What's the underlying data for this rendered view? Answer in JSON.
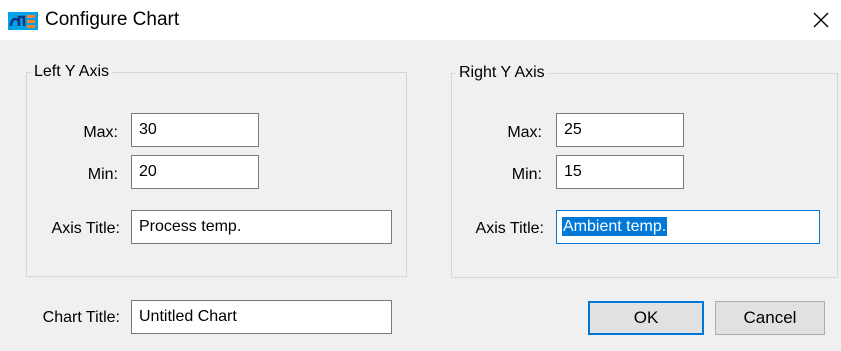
{
  "window": {
    "title": "Configure Chart",
    "icon": "chart-app-icon",
    "close_icon": "close-icon"
  },
  "left_axis": {
    "legend": "Left Y Axis",
    "max_label": "Max:",
    "max_value": "30",
    "min_label": "Min:",
    "min_value": "20",
    "title_label": "Axis Title:",
    "title_value": "Process temp."
  },
  "right_axis": {
    "legend": "Right Y Axis",
    "max_label": "Max:",
    "max_value": "25",
    "min_label": "Min:",
    "min_value": "15",
    "title_label": "Axis Title:",
    "title_value": "Ambient temp."
  },
  "chart": {
    "title_label": "Chart Title:",
    "title_value": "Untitled Chart"
  },
  "buttons": {
    "ok": "OK",
    "cancel": "Cancel"
  },
  "colors": {
    "accent": "#0078d7",
    "dialog_bg": "#f0f0f0",
    "icon_blue": "#00a2e8",
    "icon_orange": "#ff7f27"
  }
}
